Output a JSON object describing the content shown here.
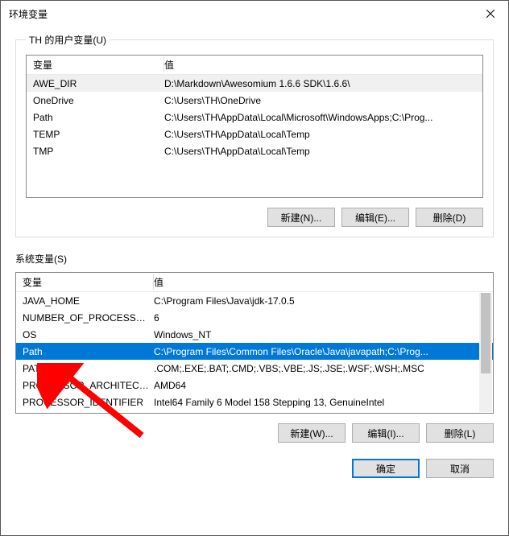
{
  "window": {
    "title": "环境变量"
  },
  "user_section": {
    "legend": "TH 的用户变量(U)",
    "columns": {
      "name": "变量",
      "value": "值"
    },
    "rows": [
      {
        "name": "AWE_DIR",
        "value": "D:\\Markdown\\Awesomium 1.6.6 SDK\\1.6.6\\",
        "state": "inactive"
      },
      {
        "name": "OneDrive",
        "value": "C:\\Users\\TH\\OneDrive",
        "state": ""
      },
      {
        "name": "Path",
        "value": "C:\\Users\\TH\\AppData\\Local\\Microsoft\\WindowsApps;C:\\Prog...",
        "state": ""
      },
      {
        "name": "TEMP",
        "value": "C:\\Users\\TH\\AppData\\Local\\Temp",
        "state": ""
      },
      {
        "name": "TMP",
        "value": "C:\\Users\\TH\\AppData\\Local\\Temp",
        "state": ""
      }
    ],
    "buttons": {
      "new": "新建(N)...",
      "edit": "编辑(E)...",
      "delete": "删除(D)"
    }
  },
  "system_section": {
    "label": "系统变量(S)",
    "columns": {
      "name": "变量",
      "value": "值"
    },
    "rows": [
      {
        "name": "JAVA_HOME",
        "value": "C:\\Program Files\\Java\\jdk-17.0.5",
        "state": ""
      },
      {
        "name": "NUMBER_OF_PROCESSORS",
        "value": "6",
        "state": ""
      },
      {
        "name": "OS",
        "value": "Windows_NT",
        "state": ""
      },
      {
        "name": "Path",
        "value": "C:\\Program Files\\Common Files\\Oracle\\Java\\javapath;C:\\Prog...",
        "state": "selected"
      },
      {
        "name": "PATHEXT",
        "value": ".COM;.EXE;.BAT;.CMD;.VBS;.VBE;.JS;.JSE;.WSF;.WSH;.MSC",
        "state": ""
      },
      {
        "name": "PROCESSOR_ARCHITECT...",
        "value": "AMD64",
        "state": ""
      },
      {
        "name": "PROCESSOR_IDENTIFIER",
        "value": "Intel64 Family 6 Model 158 Stepping 13, GenuineIntel",
        "state": ""
      }
    ],
    "buttons": {
      "new": "新建(W)...",
      "edit": "编辑(I)...",
      "delete": "删除(L)"
    }
  },
  "footer": {
    "ok": "确定",
    "cancel": "取消"
  }
}
